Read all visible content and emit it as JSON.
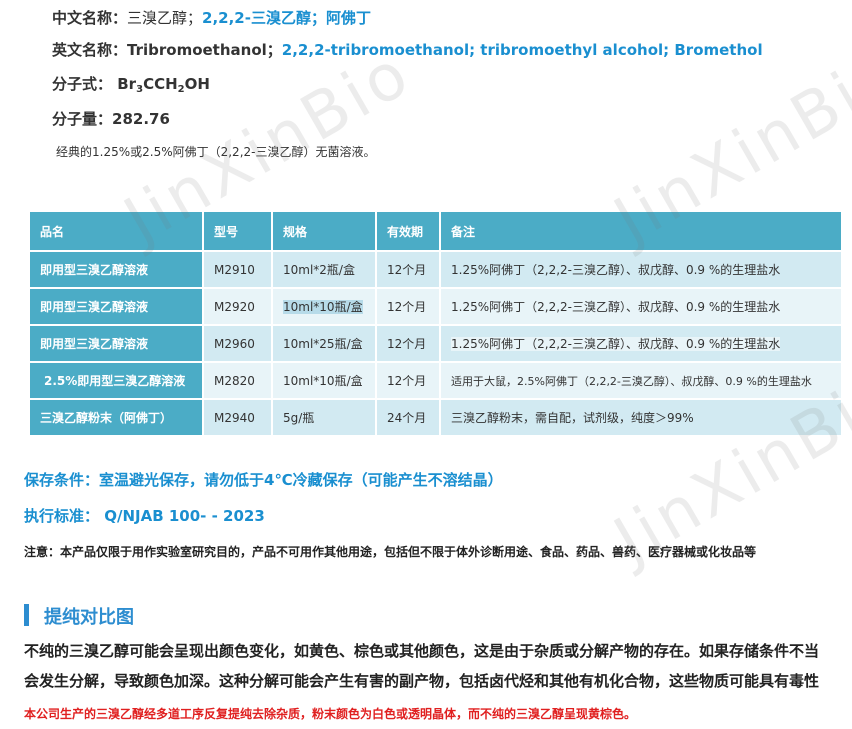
{
  "info": {
    "cn_name_label": "中文名称：",
    "cn_name_value_plain": "三溴乙醇；",
    "cn_name_value_blue": "2,2,2-三溴乙醇；阿佛丁",
    "en_name_label": "英文名称：",
    "en_name_value_plain": "Tribromoethanol；",
    "en_name_value_blue": "2,2,2-tribromoethanol; tribromoethyl alcohol; Bromethol",
    "formula_label": "分子式：",
    "formula_part1": "Br",
    "formula_sub1": "3",
    "formula_part2": "CCH",
    "formula_sub2": "2",
    "formula_part3": "OH",
    "mw_label": "分子量：",
    "mw_value": "282.76",
    "desc": "经典的1.25%或2.5%阿佛丁（2,2,2-三溴乙醇）无菌溶液。"
  },
  "table": {
    "headers": [
      "品名",
      "型号",
      "规格",
      "有效期",
      "备注"
    ],
    "rows": [
      {
        "name": "即用型三溴乙醇溶液",
        "model": "M2910",
        "spec": "10ml*2瓶/盒",
        "validity": "12个月",
        "remark": "1.25%阿佛丁（2,2,2-三溴乙醇）、叔戊醇、0.9 %的生理盐水"
      },
      {
        "name": "即用型三溴乙醇溶液",
        "model": "M2920",
        "spec": "10ml*10瓶/盒",
        "validity": "12个月",
        "remark": "1.25%阿佛丁（2,2,2-三溴乙醇）、叔戊醇、0.9 %的生理盐水"
      },
      {
        "name": "即用型三溴乙醇溶液",
        "model": "M2960",
        "spec": "10ml*25瓶/盒",
        "validity": "12个月",
        "remark": "1.25%阿佛丁（2,2,2-三溴乙醇）、叔戊醇、0.9 %的生理盐水"
      },
      {
        "name": "2.5%即用型三溴乙醇溶液",
        "model": "M2820",
        "spec": "10ml*10瓶/盒",
        "validity": "12个月",
        "remark": "适用于大鼠，2.5%阿佛丁（2,2,2-三溴乙醇）、叔戊醇、0.9 %的生理盐水"
      },
      {
        "name": "三溴乙醇粉末（阿佛丁）",
        "model": "M2940",
        "spec": "5g/瓶",
        "validity": "24个月",
        "remark": "三溴乙醇粉末，需自配，试剂级，纯度＞99%"
      }
    ]
  },
  "storage": "保存条件：室温避光保存，请勿低于4℃冷藏保存（可能产生不溶结晶）",
  "standard": "执行标准： Q/NJAB 100- - 2023",
  "notice": "注意：本产品仅限于用作实验室研究目的，产品不可用作其他用途，包括但不限于体外诊断用途、食品、药品、兽药、医疗器械或化妆品等",
  "section_title": "提纯对比图",
  "para_line1": "不纯的三溴乙醇可能会呈现出颜色变化，如黄色、棕色或其他颜色，这是由于杂质或分解产物的存在。如果存储条件不当",
  "para_line2": "会发生分解，导致颜色加深。这种分解可能会产生有害的副产物，包括卤代烃和其他有机化合物，这些物质可能具有毒性",
  "red_note": "本公司生产的三溴乙醇经多道工序反复提纯去除杂质，粉末颜色为白色或透明晶体，而不纯的三溴乙醇呈现黄棕色。",
  "watermark": "JinXinBio",
  "colors": {
    "accent_blue": "#1a8fd0",
    "header_teal": "#4bacc6",
    "warning_red": "#e02020"
  }
}
